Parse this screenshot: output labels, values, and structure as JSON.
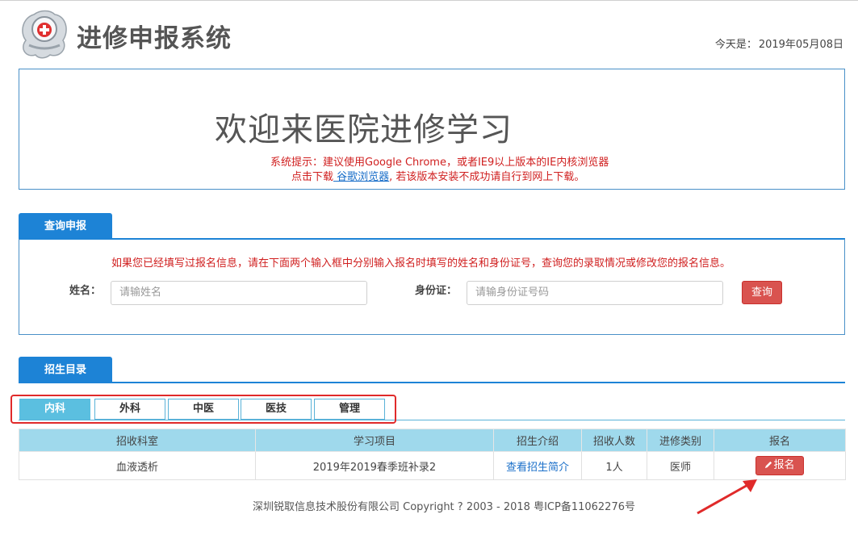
{
  "header": {
    "site_title": "进修申报系统",
    "today_label": "今天是：",
    "today_date": "2019年05月08日"
  },
  "welcome": {
    "title": "欢迎来医院进修学习",
    "notice_line1": "系统提示：建议使用Google Chrome，或者IE9以上版本的IE内核浏览器",
    "notice_prefix": "点击下载",
    "notice_link": " 谷歌浏览器",
    "notice_suffix": ", 若该版本安装不成功请自行到网上下载。"
  },
  "query": {
    "tab_label": "查询申报",
    "hint": "如果您已经填写过报名信息，请在下面两个输入框中分别输入报名时填写的姓名和身份证号，查询您的录取情况或修改您的报名信息。",
    "name_label": "姓名：",
    "name_placeholder": "请输姓名",
    "id_label": "身份证：",
    "id_placeholder": "请输身份证号码",
    "search_button": "查询"
  },
  "catalog": {
    "tab_label": "招生目录",
    "categories": [
      "内科",
      "外科",
      "中医",
      "医技",
      "管理"
    ],
    "active_category": "内科",
    "columns": [
      "招收科室",
      "学习项目",
      "招生介绍",
      "招收人数",
      "进修类别",
      "报名"
    ],
    "rows": [
      {
        "department": "血液透析",
        "program": "2019年2019春季班补录2",
        "intro_link": "查看招生简介",
        "quota": "1人",
        "type": "医师",
        "signup_label": "报名"
      }
    ]
  },
  "footer": {
    "text": "深圳锐取信息技术股份有限公司 Copyright ? 2003 - 2018 粤ICP备11062276号"
  },
  "colors": {
    "primary_blue": "#1d83d6",
    "danger_red": "#d9534f",
    "table_header": "#9fd9ec",
    "active_tab": "#5bbfe0"
  }
}
